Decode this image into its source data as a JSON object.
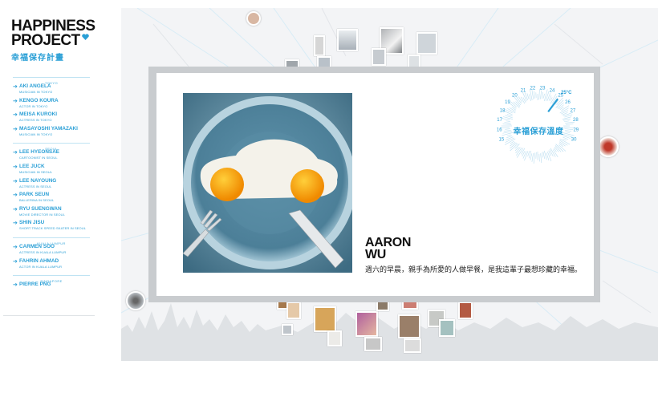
{
  "brand": {
    "title_line1": "HAPPINESS",
    "title_line2": "PROJECT",
    "subtitle_cn": "幸福保存計畫",
    "accent_color": "#2a9fd6",
    "heart_icon": "heart-icon"
  },
  "nav": {
    "groups": [
      {
        "city": "TOKYO",
        "people": [
          {
            "name": "AKI ANGELA",
            "role": "MUSICIAN IN TOKYO",
            "active": true
          },
          {
            "name": "KENGO KOURA",
            "role": "ACTOR IN TOKYO"
          },
          {
            "name": "MEISA KUROKI",
            "role": "ACTRESS IN TOKYO"
          },
          {
            "name": "MASAYOSHI YAMAZAKI",
            "role": "MUSICIAN IN TOKYO"
          }
        ]
      },
      {
        "city": "SEOUL",
        "people": [
          {
            "name": "LEE HYEONSAE",
            "role": "CARTOONIST IN SEOUL"
          },
          {
            "name": "LEE JUCK",
            "role": "MUSICIAN IN SEOUL"
          },
          {
            "name": "LEE NAYOUNG",
            "role": "ACTRESS IN SEOUL"
          },
          {
            "name": "PARK SEUN",
            "role": "BALLERINA IN SEOUL"
          },
          {
            "name": "RYU SUENGWAN",
            "role": "MOVIE DIRECTOR IN SEOUL"
          },
          {
            "name": "SHIN JISU",
            "role": "SHORT TRACK SPEED SKATER IN SEOUL"
          }
        ]
      },
      {
        "city": "KUALA LUMPUR",
        "people": [
          {
            "name": "CARMEN SOO",
            "role": "ACTRESS IN KUALA LUMPUR"
          },
          {
            "name": "FAHRIN AHMAD",
            "role": "ACTOR IN KUALA LUMPUR"
          }
        ]
      },
      {
        "city": "SINGAPORE",
        "people": [
          {
            "name": "PIERRE PNG",
            "role": ""
          }
        ]
      }
    ]
  },
  "card": {
    "person_first": "AARON",
    "person_last": "WU",
    "quote": "週六的早晨，親手為所愛的人做早餐，是我這輩子最想珍藏的幸福。",
    "photo_desc_icon": "breakfast-car-photo"
  },
  "gauge": {
    "label": "幸福保存溫度",
    "ticks": [
      "15",
      "16",
      "17",
      "18",
      "19",
      "20",
      "21",
      "22",
      "23",
      "24",
      "25",
      "26",
      "27",
      "28",
      "29",
      "30"
    ],
    "temperature": "25°C",
    "value": 25
  }
}
